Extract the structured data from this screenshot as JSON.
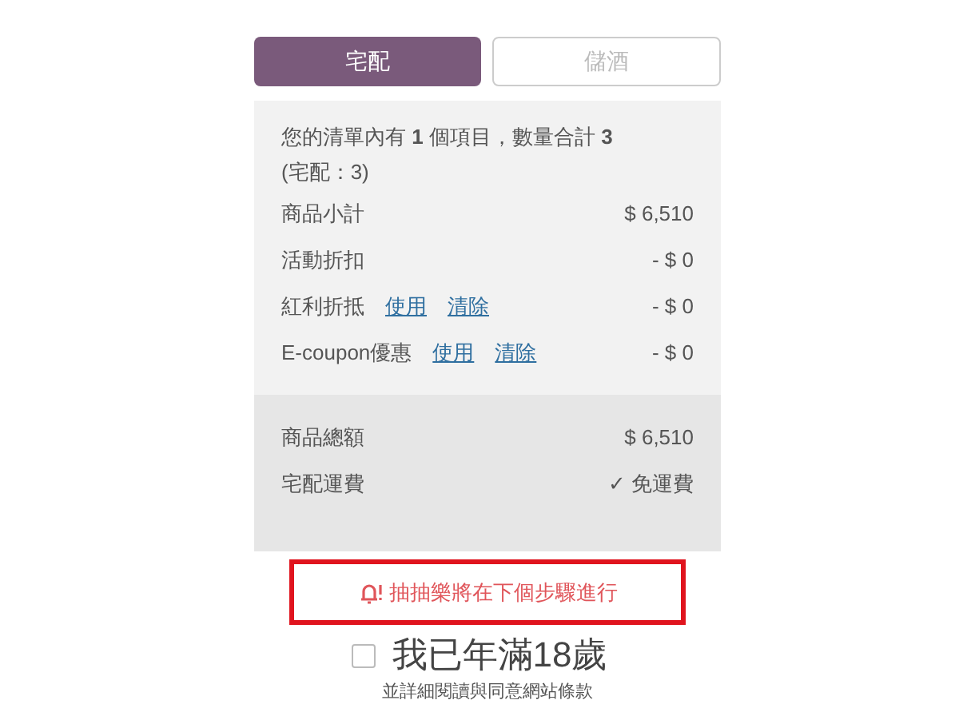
{
  "tabs": [
    {
      "label": "宅配",
      "selected": true
    },
    {
      "label": "儲酒",
      "selected": false
    }
  ],
  "summary": {
    "text": "您的清單內有 **1** 個項目，數量合計 **3**",
    "note": "(宅配：3)"
  },
  "lines": [
    {
      "label": "商品小計",
      "amount": "$ 6,510"
    },
    {
      "label": "活動折扣",
      "amount": "- $ 0"
    },
    {
      "label": "紅利折抵",
      "links": [
        "使用",
        "清除"
      ],
      "amount": "- $ 0"
    },
    {
      "label": "E-coupon優惠",
      "links": [
        "使用",
        "清除"
      ],
      "amount": "- $ 0"
    }
  ],
  "totals": [
    {
      "label": "商品總額",
      "amount": "$ 6,510"
    },
    {
      "label": "宅配運費",
      "amount": "✓ 免運費"
    }
  ],
  "notice": "抽抽樂將在下個步驟進行",
  "age_check": {
    "label": "我已年滿18歲",
    "checked": false,
    "note": "並詳細閱讀與同意網站條款"
  }
}
